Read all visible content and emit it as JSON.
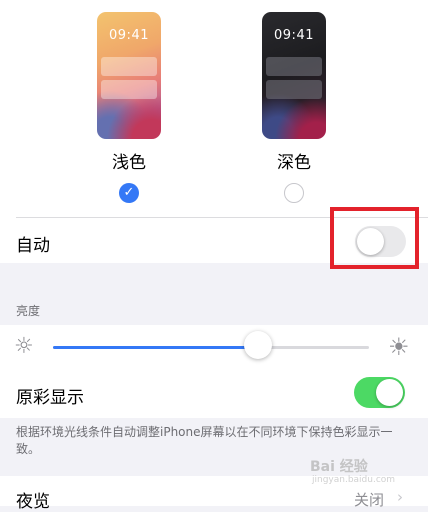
{
  "appearance": {
    "light": {
      "time": "09:41",
      "label": "浅色",
      "selected": true
    },
    "dark": {
      "time": "09:41",
      "label": "深色",
      "selected": false
    }
  },
  "automatic": {
    "label": "自动",
    "on": false
  },
  "brightness": {
    "header": "亮度",
    "level": 0.65
  },
  "true_tone": {
    "label": "原彩显示",
    "on": true,
    "note": "根据环境光线条件自动调整iPhone屏幕以在不同环境下保持色彩显示一致。"
  },
  "night_shift": {
    "label": "夜览",
    "value": "关闭"
  },
  "watermark": {
    "text": "Bai 经验",
    "sub": "jingyan.baidu.com"
  },
  "colors": {
    "accent": "#3478f6",
    "toggle_on": "#4cd964",
    "highlight": "#e3222b"
  },
  "icons": {
    "check": "✓",
    "sun_small": "☼",
    "sun_large": "☀",
    "chevron": "›"
  }
}
